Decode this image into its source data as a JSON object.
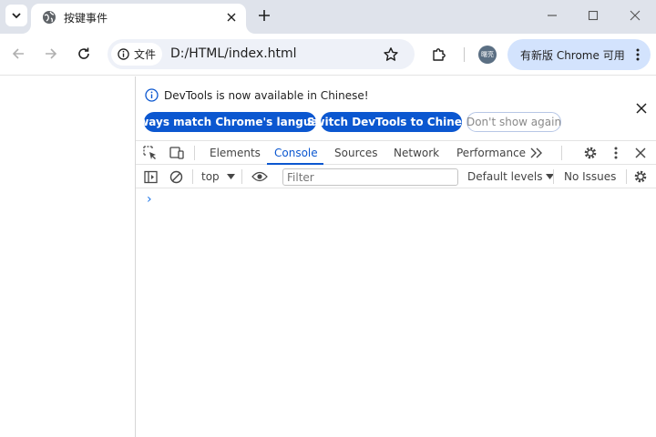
{
  "browser": {
    "tab": {
      "title": "按键事件"
    },
    "address": {
      "site_chip_label": "文件",
      "url": "D:/HTML/index.html"
    },
    "profile_avatar_text": "曙亮",
    "update_button_label": "有新版 Chrome 可用"
  },
  "devtools": {
    "infobar": {
      "message": "DevTools is now available in Chinese!",
      "buttons": {
        "match_language": "Always match Chrome's language",
        "switch_chinese": "Switch DevTools to Chinese",
        "dont_show": "Don't show again"
      }
    },
    "tabs": [
      "Elements",
      "Console",
      "Sources",
      "Network",
      "Performance"
    ],
    "active_tab": "Console",
    "console": {
      "context": "top",
      "filter_placeholder": "Filter",
      "levels": "Default levels",
      "issues": "No Issues",
      "prompt": "›"
    }
  },
  "colors": {
    "tabstrip_bg": "#dfe3eb",
    "accent_blue": "#0b57d0",
    "update_button_bg": "#d3e3fd",
    "omnibox_bg": "#eef1f8"
  }
}
